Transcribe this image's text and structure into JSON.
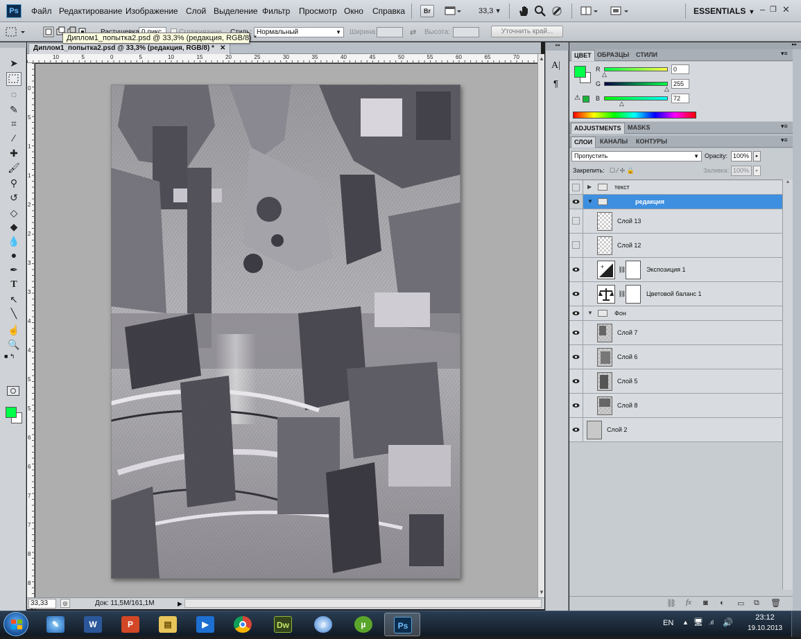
{
  "app": {
    "logo": "Ps"
  },
  "menu": [
    "Файл",
    "Редактирование",
    "Изображение",
    "Слой",
    "Выделение",
    "Фильтр",
    "Просмотр",
    "Окно",
    "Справка"
  ],
  "menubar": {
    "bridge": "Br",
    "zoom": "33,3",
    "workspace": "ESSENTIALS"
  },
  "options": {
    "feather_label": "Растушевка:",
    "feather_value": "0 пикс",
    "antialias_label": "Сглаживание",
    "style_label": "Стиль:",
    "style_value": "Нормальный",
    "width_label": "Ширина:",
    "height_label": "Высота:",
    "refine_button": "Уточнить край..."
  },
  "tooltip": "Диплом1_попытка2.psd @ 33,3% (редакция, RGB/8) *",
  "document": {
    "tab_title": "Диплом1_попытка2.psd @ 33,3% (редакция, RGB/8) *",
    "ruler_top": [
      "10",
      "5",
      "0",
      "5",
      "10",
      "15",
      "20",
      "25",
      "30",
      "35",
      "40",
      "45",
      "50",
      "55",
      "60",
      "65",
      "70"
    ],
    "ruler_left": [
      "0",
      "5",
      "1",
      "1",
      "2",
      "2",
      "3",
      "3",
      "4",
      "4",
      "5",
      "5",
      "6",
      "6",
      "7",
      "7",
      "8",
      "8"
    ],
    "zoom": "33,33 %",
    "doc_size": "Док: 11,5M/161,1M"
  },
  "color_panel": {
    "tabs": [
      "ЦВЕТ",
      "ОБРАЗЦЫ",
      "СТИЛИ"
    ],
    "r_label": "R",
    "g_label": "G",
    "b_label": "B",
    "r": "0",
    "g": "255",
    "b": "72",
    "foreground": "#00ff48"
  },
  "adjustments_tabs": [
    "ADJUSTMENTS",
    "MASKS"
  ],
  "layers_panel": {
    "tabs": [
      "СЛОИ",
      "КАНАЛЫ",
      "КОНТУРЫ"
    ],
    "blend_mode": "Пропустить",
    "opacity_label": "Opacity:",
    "opacity": "100%",
    "lock_label": "Закрепить:",
    "fill_label": "Заливка:",
    "fill": "100%",
    "layers": [
      {
        "name": "текст"
      },
      {
        "name": "редакция"
      },
      {
        "name": "Слой 13"
      },
      {
        "name": "Слой 12"
      },
      {
        "name": "Экспозиция 1"
      },
      {
        "name": "Цветовой баланс 1"
      },
      {
        "name": "Фон"
      },
      {
        "name": "Слой 7"
      },
      {
        "name": "Слой 6"
      },
      {
        "name": "Слой 5"
      },
      {
        "name": "Слой 8"
      },
      {
        "name": "Слой 2"
      }
    ]
  },
  "taskbar": {
    "apps": [
      "explorer",
      "word",
      "powerpoint",
      "folder",
      "media",
      "chrome",
      "Dw",
      "itunes",
      "utorrent",
      "Ps"
    ],
    "lang": "EN",
    "time": "23:12",
    "date": "19.10.2013"
  }
}
